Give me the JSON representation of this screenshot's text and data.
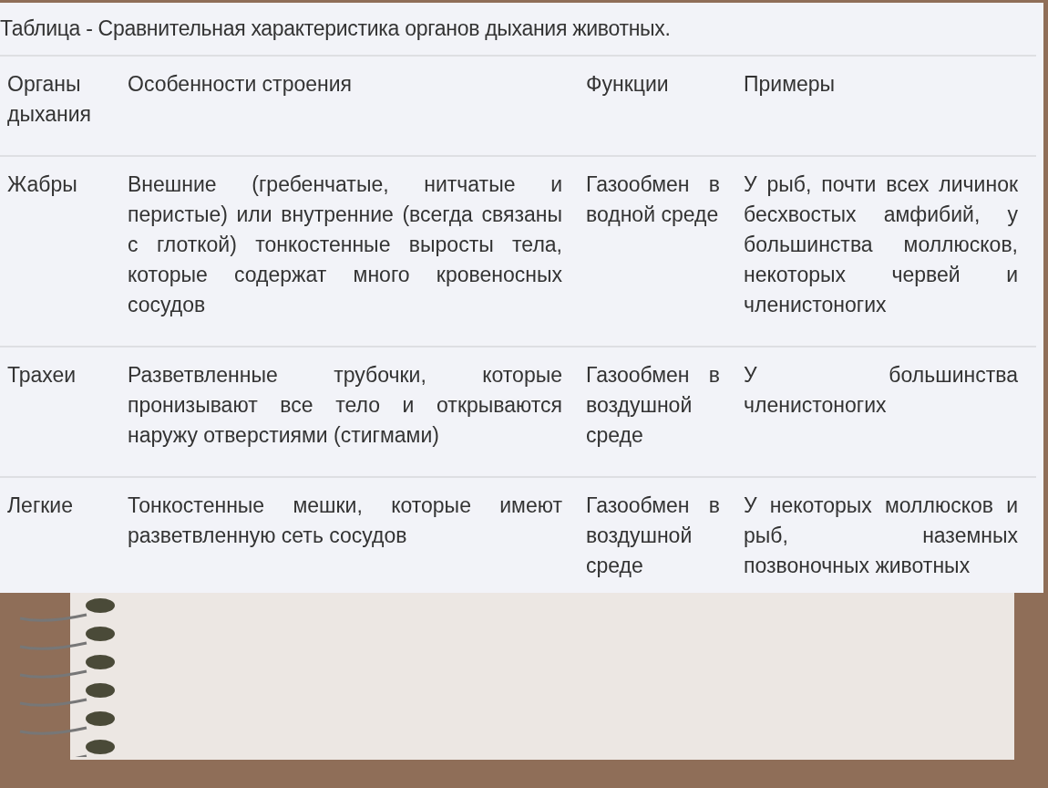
{
  "caption": "Таблица - Сравнительная характеристика органов дыхания животных.",
  "table": {
    "columns": [
      "Органы дыхания",
      "Особенности строения",
      "Функции",
      "Примеры"
    ],
    "rows": [
      {
        "cells": [
          "Жабры",
          "Внешние (гребенчатые, нитчатые и перистые) или внутренние (всегда связаны с глоткой) тонкостенные выросты тела, которые содержат много кровеносных сосудов",
          "Газообмен в водной среде",
          "У рыб, почти всех личинок бесхвостых амфибий, у большинства моллюсков, некоторых червей и членистоногих"
        ]
      },
      {
        "cells": [
          "Трахеи",
          "Разветвленные трубочки, которые пронизывают все тело и открываются наружу отверстиями (стигмами)",
          "Газообмен в воздушной среде",
          "У большинства членистоногих"
        ]
      },
      {
        "cells": [
          "Легкие",
          "Тонкостенные мешки, которые имеют разветвленную сеть сосудов",
          "Газообмен в воздушной среде",
          "У некоторых моллюсков и рыб, наземных позвоночных животных"
        ]
      }
    ]
  }
}
